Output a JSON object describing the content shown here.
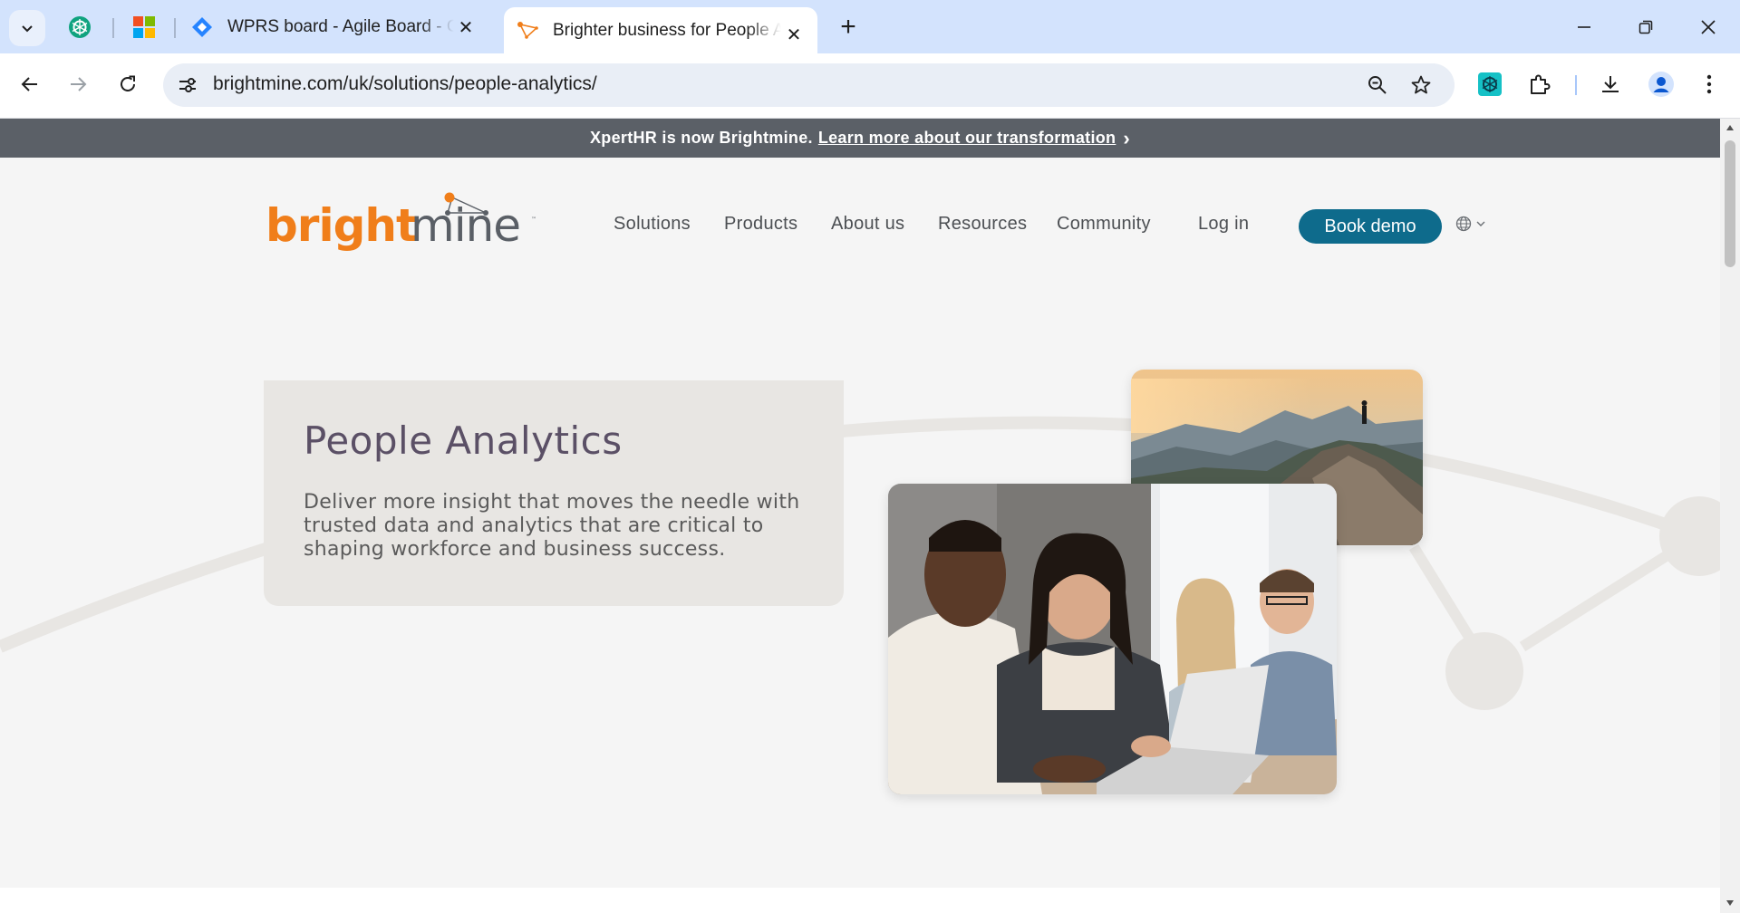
{
  "browser": {
    "tabs": [
      {
        "title": "WPRS board - Agile Board - CE",
        "active": false
      },
      {
        "title": "Brighter business for People Analytics",
        "active": true
      }
    ],
    "new_tab_symbol": "+",
    "url": "brightmine.com/uk/solutions/people-analytics/"
  },
  "banner": {
    "text": "XpertHR is now Brightmine.",
    "link": "Learn more about our transformation",
    "chevron": "›"
  },
  "site": {
    "logo_text": "brightmine",
    "nav": [
      "Solutions",
      "Products",
      "About us",
      "Resources",
      "Community",
      "Log in"
    ],
    "cta": "Book demo"
  },
  "hero": {
    "title": "People Analytics",
    "body": "Deliver more insight that moves the needle with trusted data and analytics that are critical to shaping workforce and business success."
  },
  "colors": {
    "brand_orange": "#f07e1a",
    "brand_gray": "#5a5f66",
    "cta_teal": "#0e6b8c",
    "banner_gray": "#5b6067"
  }
}
